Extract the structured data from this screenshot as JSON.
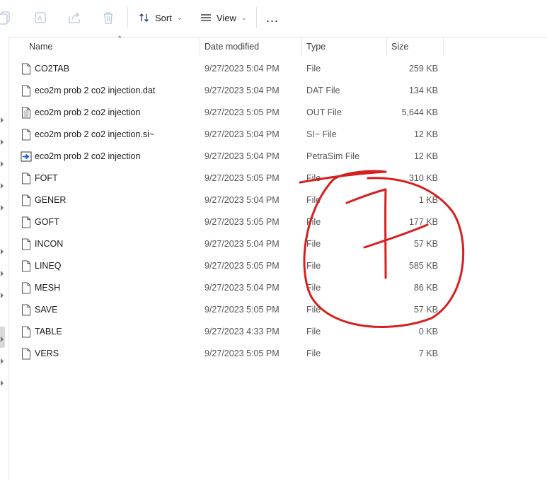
{
  "toolbar": {
    "sort_label": "Sort",
    "view_label": "View",
    "more_label": "..."
  },
  "columns": {
    "name": "Name",
    "date": "Date modified",
    "type": "Type",
    "size": "Size"
  },
  "files": [
    {
      "name": "CO2TAB",
      "date": "9/27/2023 5:04 PM",
      "type": "File",
      "size": "259 KB",
      "icon": "file-icon"
    },
    {
      "name": "eco2m prob 2 co2 injection.dat",
      "date": "9/27/2023 5:04 PM",
      "type": "DAT File",
      "size": "134 KB",
      "icon": "file-icon"
    },
    {
      "name": "eco2m prob 2 co2 injection",
      "date": "9/27/2023 5:05 PM",
      "type": "OUT File",
      "size": "5,644 KB",
      "icon": "text-file-icon"
    },
    {
      "name": "eco2m prob 2 co2 injection.si~",
      "date": "9/27/2023 5:04 PM",
      "type": "SI~ File",
      "size": "12 KB",
      "icon": "file-icon"
    },
    {
      "name": "eco2m prob 2 co2 injection",
      "date": "9/27/2023 5:04 PM",
      "type": "PetraSim File",
      "size": "12 KB",
      "icon": "petrasim-file-icon"
    },
    {
      "name": "FOFT",
      "date": "9/27/2023 5:05 PM",
      "type": "File",
      "size": "310 KB",
      "icon": "file-icon"
    },
    {
      "name": "GENER",
      "date": "9/27/2023 5:04 PM",
      "type": "File",
      "size": "1 KB",
      "icon": "file-icon"
    },
    {
      "name": "GOFT",
      "date": "9/27/2023 5:05 PM",
      "type": "File",
      "size": "177 KB",
      "icon": "file-icon"
    },
    {
      "name": "INCON",
      "date": "9/27/2023 5:04 PM",
      "type": "File",
      "size": "57 KB",
      "icon": "file-icon"
    },
    {
      "name": "LINEQ",
      "date": "9/27/2023 5:05 PM",
      "type": "File",
      "size": "585 KB",
      "icon": "file-icon"
    },
    {
      "name": "MESH",
      "date": "9/27/2023 5:04 PM",
      "type": "File",
      "size": "86 KB",
      "icon": "file-icon"
    },
    {
      "name": "SAVE",
      "date": "9/27/2023 5:05 PM",
      "type": "File",
      "size": "57 KB",
      "icon": "file-icon"
    },
    {
      "name": "TABLE",
      "date": "9/27/2023 4:33 PM",
      "type": "File",
      "size": "0 KB",
      "icon": "file-icon"
    },
    {
      "name": "VERS",
      "date": "9/27/2023 5:05 PM",
      "type": "File",
      "size": "7 KB",
      "icon": "file-icon"
    }
  ],
  "colors": {
    "annotation": "#d61f1f",
    "petrasim_icon": "#1f5bd6"
  }
}
